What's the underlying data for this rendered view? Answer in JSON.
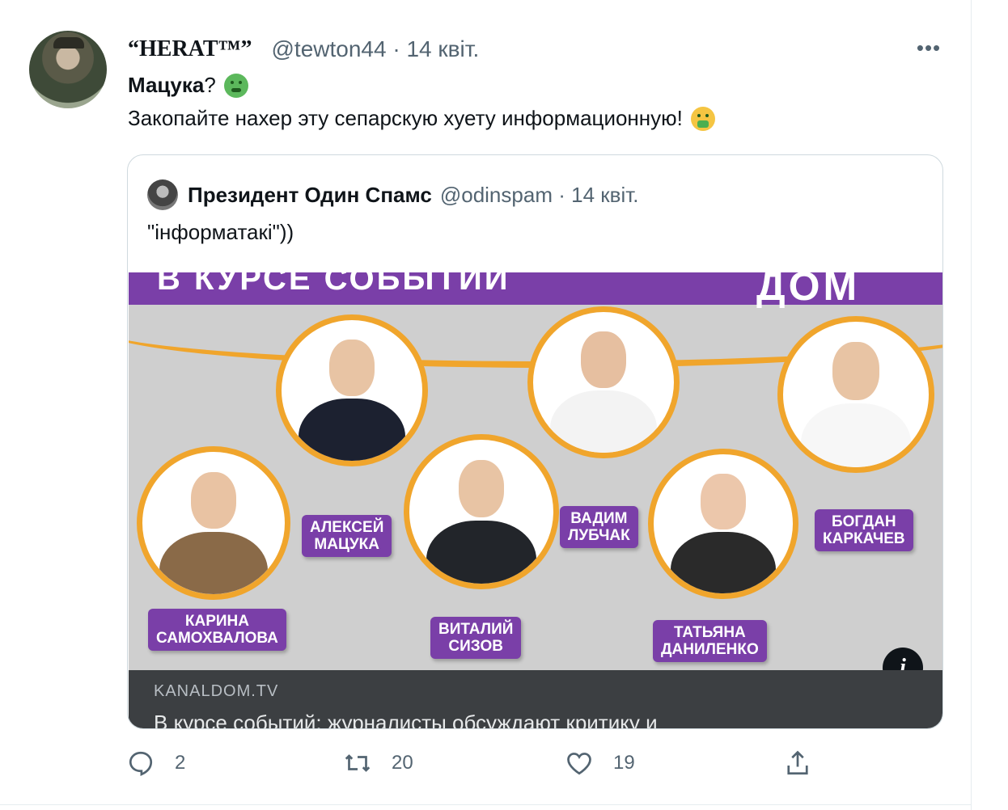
{
  "tweet": {
    "display_name": "“HERAT™”",
    "handle": "@tewton44",
    "separator": "·",
    "date": "14 квіт.",
    "line1_bold": "Мацука",
    "line1_rest": "?",
    "line2": "Закопайте нахер эту сепарскую хуету информационную!",
    "more_label": "•••"
  },
  "quoted": {
    "name": "Президент Один Спамс",
    "handle": "@odinspam",
    "separator": "·",
    "date": "14 квіт.",
    "text": "\"інформатакі\"))",
    "card": {
      "banner_text": "В КУРСЕ СОБЫТИЙ",
      "logo": "ДОМ",
      "people": [
        {
          "line1": "КАРИНА",
          "line2": "САМОХВАЛОВА"
        },
        {
          "line1": "АЛЕКСЕЙ",
          "line2": "МАЦУКА"
        },
        {
          "line1": "ВИТАЛИЙ",
          "line2": "СИЗОВ"
        },
        {
          "line1": "ВАДИМ",
          "line2": "ЛУБЧАК"
        },
        {
          "line1": "ТАТЬЯНА",
          "line2": "ДАНИЛЕНКО"
        },
        {
          "line1": "БОГДАН",
          "line2": "КАРКАЧЕВ"
        }
      ],
      "domain": "KANALDOM.TV",
      "title": "В курсе событий: журналисты обсуждают критику и"
    }
  },
  "actions": {
    "reply_count": "2",
    "retweet_count": "20",
    "like_count": "19"
  },
  "colors": {
    "accent_purple": "#7a3fa8",
    "accent_orange": "#f0a52c",
    "muted_text": "#536471"
  }
}
